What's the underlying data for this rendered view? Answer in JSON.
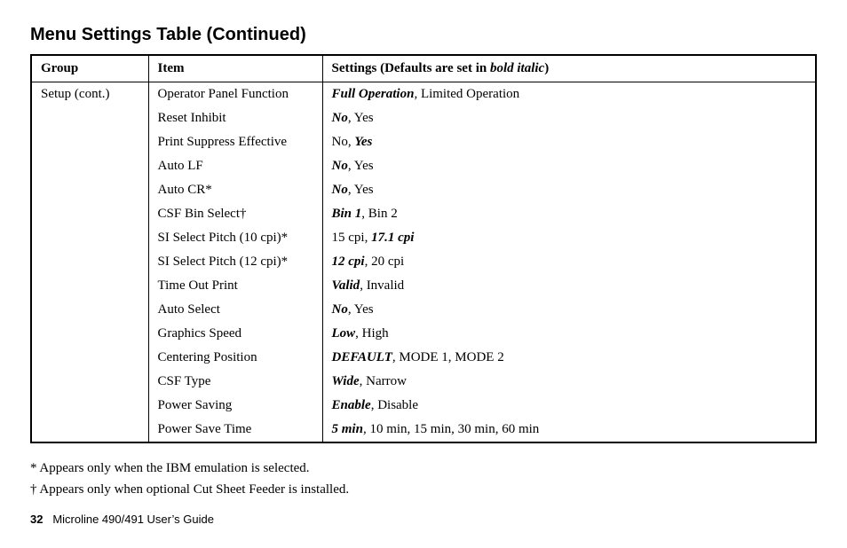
{
  "title": "Menu Settings Table (Continued)",
  "headers": {
    "group": "Group",
    "item": "Item",
    "settings_prefix": "Settings (Defaults are set in ",
    "settings_bold": "bold italic",
    "settings_suffix": ")"
  },
  "group_label": "Setup (cont.)",
  "rows": [
    {
      "item": "Operator Panel Function",
      "settings": [
        {
          "t": "Full Operation",
          "d": true
        },
        {
          "t": ", Limited Operation"
        }
      ]
    },
    {
      "item": "Reset Inhibit",
      "settings": [
        {
          "t": "No",
          "d": true
        },
        {
          "t": ", Yes"
        }
      ]
    },
    {
      "item": "Print Suppress Effective",
      "settings": [
        {
          "t": "No, "
        },
        {
          "t": "Yes",
          "d": true
        }
      ]
    },
    {
      "item": "Auto LF",
      "settings": [
        {
          "t": "No",
          "d": true
        },
        {
          "t": ", Yes"
        }
      ]
    },
    {
      "item": "Auto CR*",
      "settings": [
        {
          "t": "No",
          "d": true
        },
        {
          "t": ", Yes"
        }
      ]
    },
    {
      "item": "CSF Bin Select†",
      "settings": [
        {
          "t": "Bin 1",
          "d": true
        },
        {
          "t": ", Bin 2"
        }
      ]
    },
    {
      "item": "SI Select Pitch (10 cpi)*",
      "settings": [
        {
          "t": "15 cpi, "
        },
        {
          "t": "17.1 cpi",
          "d": true
        }
      ]
    },
    {
      "item": "SI Select Pitch (12 cpi)*",
      "settings": [
        {
          "t": "12 cpi",
          "d": true
        },
        {
          "t": ", 20 cpi"
        }
      ]
    },
    {
      "item": "Time Out Print",
      "settings": [
        {
          "t": "Valid",
          "d": true
        },
        {
          "t": ", Invalid"
        }
      ]
    },
    {
      "item": "Auto Select",
      "settings": [
        {
          "t": "No",
          "d": true
        },
        {
          "t": ", Yes"
        }
      ]
    },
    {
      "item": "Graphics Speed",
      "settings": [
        {
          "t": "Low",
          "d": true
        },
        {
          "t": ", High"
        }
      ]
    },
    {
      "item": "Centering Position",
      "settings": [
        {
          "t": "DEFAULT",
          "d": true
        },
        {
          "t": ", MODE 1, MODE 2"
        }
      ]
    },
    {
      "item": "CSF Type",
      "settings": [
        {
          "t": "Wide",
          "d": true
        },
        {
          "t": ", Narrow"
        }
      ]
    },
    {
      "item": "Power Saving",
      "settings": [
        {
          "t": "Enable",
          "d": true
        },
        {
          "t": ", Disable"
        }
      ]
    },
    {
      "item": "Power Save Time",
      "settings": [
        {
          "t": "5 min",
          "d": true
        },
        {
          "t": ", 10 min, 15 min, 30 min, 60 min"
        }
      ]
    }
  ],
  "footnotes": [
    "* Appears only when the IBM emulation is selected.",
    "† Appears only when optional Cut Sheet Feeder is installed."
  ],
  "footer": {
    "page_number": "32",
    "doc_title": "Microline 490/491 User’s Guide"
  }
}
